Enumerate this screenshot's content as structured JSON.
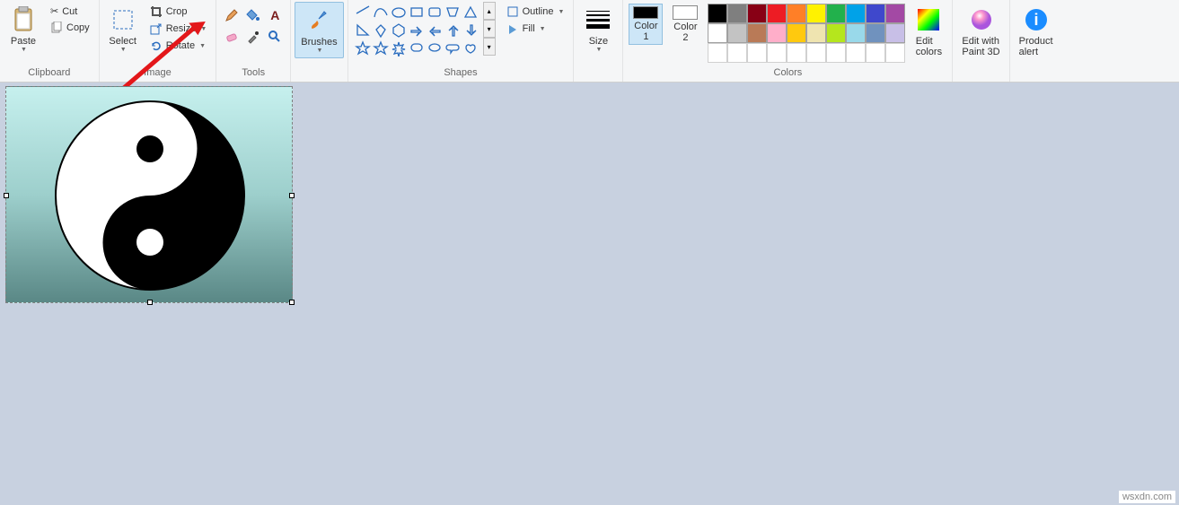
{
  "ribbon": {
    "clipboard": {
      "label": "Clipboard",
      "paste": "Paste",
      "cut": "Cut",
      "copy": "Copy"
    },
    "image": {
      "label": "Image",
      "select": "Select",
      "crop": "Crop",
      "resize": "Resize",
      "rotate": "Rotate"
    },
    "tools": {
      "label": "Tools"
    },
    "brushes": {
      "label": "Brushes",
      "btn": "Brushes"
    },
    "shapes": {
      "label": "Shapes",
      "outline": "Outline",
      "fill": "Fill"
    },
    "size": {
      "label": "Size",
      "btn": "Size"
    },
    "colors": {
      "label": "Colors",
      "c1": "Color\n1",
      "c2": "Color\n2",
      "edit": "Edit\ncolors",
      "color1_value": "#000000",
      "color2_value": "#ffffff",
      "row1": [
        "#000000",
        "#7f7f7f",
        "#880015",
        "#ed1c24",
        "#ff7f27",
        "#fff200",
        "#22b14c",
        "#00a2e8",
        "#3f48cc",
        "#a349a4"
      ],
      "row2": [
        "#ffffff",
        "#c3c3c3",
        "#b97a57",
        "#ffaec9",
        "#ffc90e",
        "#efe4b0",
        "#b5e61d",
        "#99d9ea",
        "#7092be",
        "#c8bfe7"
      ]
    },
    "edit3d": {
      "label": "Edit with\nPaint 3D"
    },
    "alert": {
      "label": "Product\nalert"
    }
  },
  "watermark": "wsxdn.com"
}
